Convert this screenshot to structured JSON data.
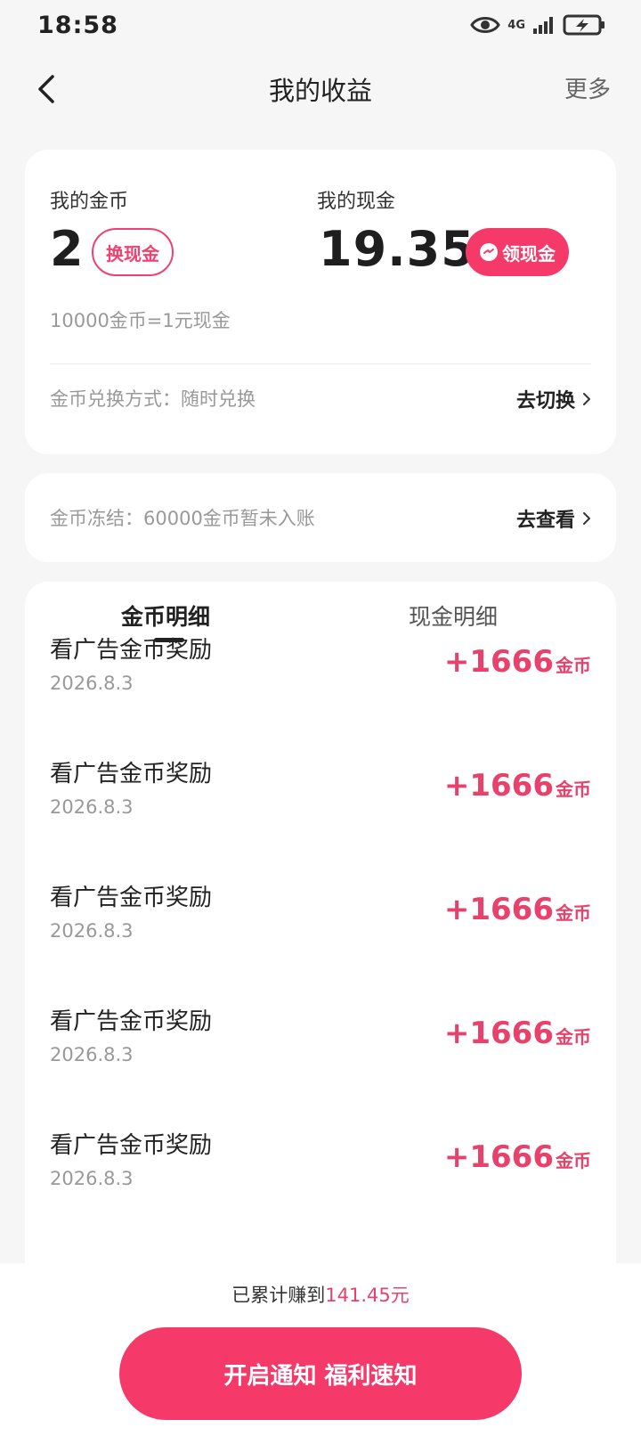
{
  "status": {
    "time": "18:58",
    "network": "4G"
  },
  "nav": {
    "title": "我的收益",
    "more": "更多"
  },
  "coins": {
    "label": "我的金币",
    "value": "2",
    "exchange_button": "换现金",
    "rate_text": "10000金币=1元现金"
  },
  "cash": {
    "label": "我的现金",
    "value": "19.35",
    "claim_button": "领现金"
  },
  "exchange_method": {
    "label": "金币兑换方式：随时兑换",
    "action": "去切换"
  },
  "frozen": {
    "label": "金币冻结：60000金币暂未入账",
    "action": "去查看"
  },
  "tabs": [
    {
      "label": "金币明细",
      "active": true
    },
    {
      "label": "现金明细",
      "active": false
    }
  ],
  "records": [
    {
      "title": "看广告金币奖励",
      "date": "2026.8.3",
      "amount": "+1666",
      "unit": "金币"
    },
    {
      "title": "看广告金币奖励",
      "date": "2026.8.3",
      "amount": "+1666",
      "unit": "金币"
    },
    {
      "title": "看广告金币奖励",
      "date": "2026.8.3",
      "amount": "+1666",
      "unit": "金币"
    },
    {
      "title": "看广告金币奖励",
      "date": "2026.8.3",
      "amount": "+1666",
      "unit": "金币"
    },
    {
      "title": "看广告金币奖励",
      "date": "2026.8.3",
      "amount": "+1666",
      "unit": "金币"
    }
  ],
  "footer": {
    "total_prefix": "已累计赚到",
    "total_value": "141.45元",
    "notify_button": "开启通知 福利速知"
  },
  "colors": {
    "accent": "#f53a6a",
    "amount": "#e8416b",
    "background": "#f6f6f6"
  }
}
